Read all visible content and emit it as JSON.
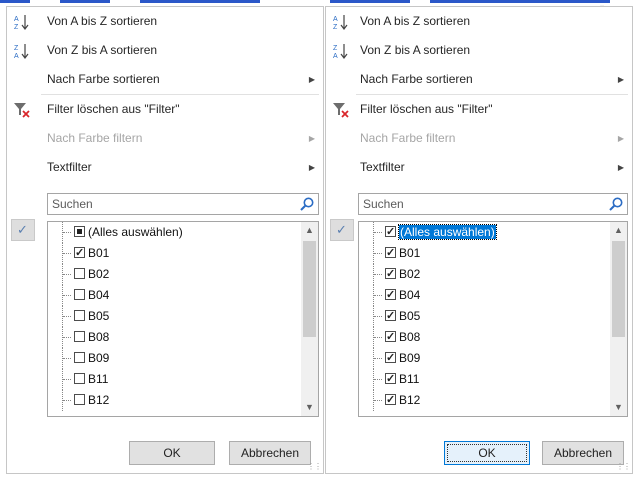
{
  "quote_mark": "„",
  "colors": {
    "accent": "#0078d7",
    "border": "#c6c6c6",
    "disabled": "#a6a6a6"
  },
  "icons": {
    "sort_az": "sort-az-icon",
    "sort_za": "sort-za-icon",
    "clear_filter": "clear-filter-icon",
    "search": "search-icon",
    "check": "check-icon",
    "submenu": "submenu-arrow-icon"
  },
  "left": {
    "menu": {
      "sort_az": "Von A bis Z sortieren",
      "sort_za": "Von Z bis A sortieren",
      "sort_color": "Nach Farbe sortieren",
      "clear_filter": "Filter löschen aus \"Filter\"",
      "filter_color": "Nach Farbe filtern",
      "text_filter": "Textfilter"
    },
    "search_placeholder": "Suchen",
    "items": [
      {
        "label": "(Alles auswählen)",
        "state": "mixed"
      },
      {
        "label": "B01",
        "state": "checked"
      },
      {
        "label": "B02",
        "state": "unchecked"
      },
      {
        "label": "B04",
        "state": "unchecked"
      },
      {
        "label": "B05",
        "state": "unchecked"
      },
      {
        "label": "B08",
        "state": "unchecked"
      },
      {
        "label": "B09",
        "state": "unchecked"
      },
      {
        "label": "B11",
        "state": "unchecked"
      },
      {
        "label": "B12",
        "state": "unchecked"
      }
    ],
    "ok": "OK",
    "cancel": "Abbrechen"
  },
  "right": {
    "menu": {
      "sort_az": "Von A bis Z sortieren",
      "sort_za": "Von Z bis A sortieren",
      "sort_color": "Nach Farbe sortieren",
      "clear_filter": "Filter löschen aus \"Filter\"",
      "filter_color": "Nach Farbe filtern",
      "text_filter": "Textfilter"
    },
    "search_placeholder": "Suchen",
    "items": [
      {
        "label": "(Alles auswählen)",
        "state": "checked",
        "selected": true
      },
      {
        "label": "B01",
        "state": "checked"
      },
      {
        "label": "B02",
        "state": "checked"
      },
      {
        "label": "B04",
        "state": "checked"
      },
      {
        "label": "B05",
        "state": "checked"
      },
      {
        "label": "B08",
        "state": "checked"
      },
      {
        "label": "B09",
        "state": "checked"
      },
      {
        "label": "B11",
        "state": "checked"
      },
      {
        "label": "B12",
        "state": "checked"
      }
    ],
    "ok": "OK",
    "cancel": "Abbrechen"
  }
}
